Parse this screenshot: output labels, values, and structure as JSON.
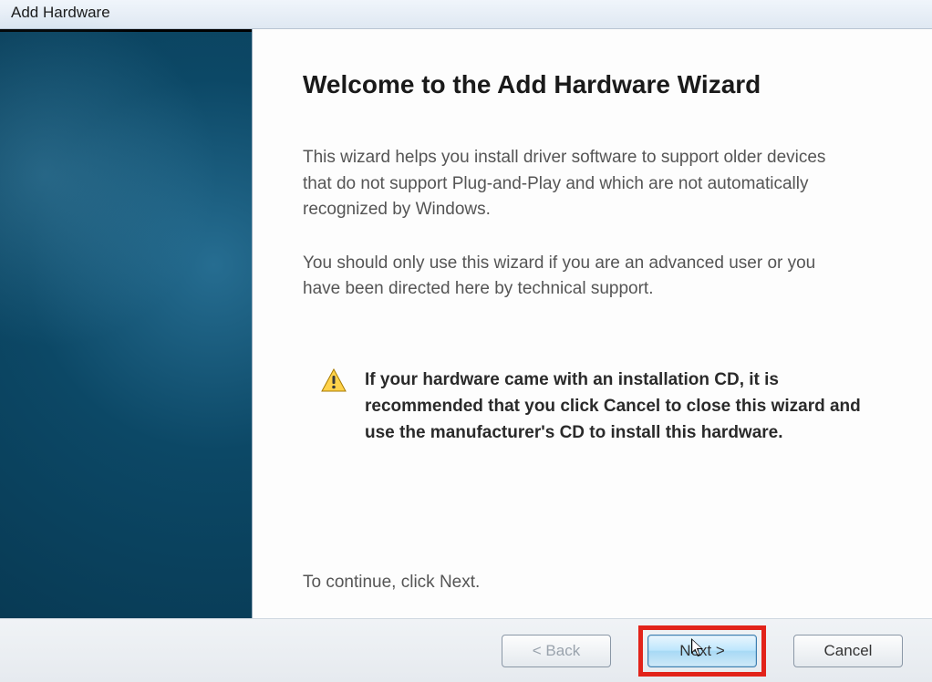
{
  "window": {
    "title": "Add Hardware"
  },
  "main": {
    "heading": "Welcome to the Add Hardware Wizard",
    "para1": "This wizard helps you install driver software to support older devices that do not support Plug-and-Play and which are not automatically recognized by Windows.",
    "para2": "You should only use this wizard if you are an advanced user or you have been directed here by technical support.",
    "warning": "If your hardware came with an installation CD, it is recommended that you click Cancel to close this wizard and use the manufacturer's CD to install this hardware.",
    "continue": "To continue, click Next."
  },
  "buttons": {
    "back": "< Back",
    "next": "Next >",
    "cancel": "Cancel"
  }
}
